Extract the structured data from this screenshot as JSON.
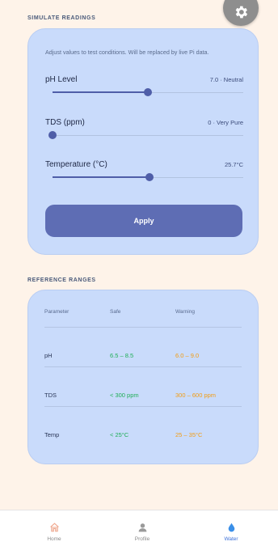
{
  "simulate": {
    "section_title": "SIMULATE READINGS",
    "hint": "Adjust values to test conditions. Will be replaced by live Pi data.",
    "sliders": [
      {
        "label": "pH Level",
        "value_text": "7.0 · Neutral",
        "level": 0.5
      },
      {
        "label": "TDS (ppm)",
        "value_text": "0 · Very Pure",
        "level": 0.0
      },
      {
        "label": "Temperature (°C)",
        "value_text": "25.7°C",
        "level": 0.51
      }
    ],
    "apply_label": "Apply"
  },
  "reference": {
    "section_title": "REFERENCE RANGES",
    "headers": [
      "Parameter",
      "Safe",
      "Warning"
    ],
    "rows": [
      {
        "param": "pH",
        "safe": "6.5 – 8.5",
        "warning": "6.0 – 9.0"
      },
      {
        "param": "TDS",
        "safe": "< 300 ppm",
        "warning": "300 – 600 ppm"
      },
      {
        "param": "Temp",
        "safe": "< 25°C",
        "warning": "25 – 35°C"
      }
    ]
  },
  "nav": {
    "items": [
      {
        "label": "Home",
        "icon": "home-icon"
      },
      {
        "label": "Profile",
        "icon": "profile-icon"
      },
      {
        "label": "Water",
        "icon": "water-drop-icon"
      }
    ],
    "active": "Water"
  },
  "colors": {
    "accent": "#5e6db4",
    "card": "#c9dbfb",
    "safe": "#1fae57",
    "warning": "#f39c12",
    "background": "#fef3e9"
  }
}
